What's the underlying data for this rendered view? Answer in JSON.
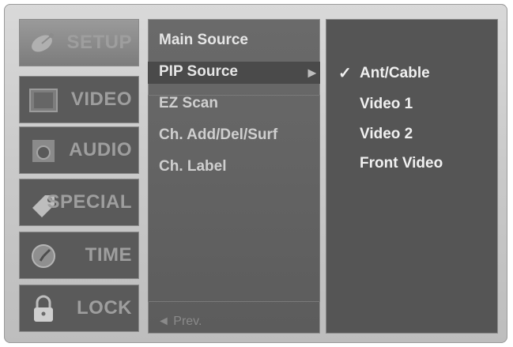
{
  "categories": [
    {
      "label": "SETUP",
      "icon": "satellite-dish-icon"
    },
    {
      "label": "VIDEO",
      "icon": "screen-icon"
    },
    {
      "label": "AUDIO",
      "icon": "speaker-icon"
    },
    {
      "label": "SPECIAL",
      "icon": "tag-icon"
    },
    {
      "label": "TIME",
      "icon": "clock-icon"
    },
    {
      "label": "LOCK",
      "icon": "padlock-icon"
    }
  ],
  "menu": {
    "items": [
      "Main Source",
      "PIP Source",
      "EZ Scan",
      "Ch. Add/Del/Surf",
      "Ch. Label"
    ],
    "selected_index": 1,
    "prev_label": "◄ Prev."
  },
  "options": {
    "checked_index": 0,
    "items": [
      "Ant/Cable",
      "Video 1",
      "Video 2",
      "Front Video"
    ]
  }
}
